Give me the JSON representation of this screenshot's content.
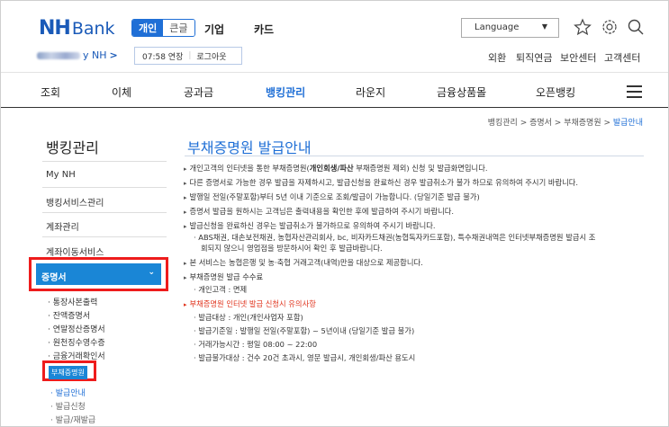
{
  "header": {
    "logo_nh": "NH",
    "logo_bank": "Bank",
    "seg_personal": "개인",
    "seg_corporate": "큰글",
    "nav_business": "기업",
    "nav_card": "카드",
    "language": "Language",
    "user_suffix": "y NH",
    "timer": "07:58 연장",
    "logout": "로그아웃",
    "util_links": [
      "외환",
      "퇴직연금",
      "보안센터",
      "고객센터"
    ]
  },
  "gnb": [
    "조회",
    "이체",
    "공과금",
    "뱅킹관리",
    "라운지",
    "금융상품몰",
    "오픈뱅킹"
  ],
  "breadcrumb": {
    "path": "뱅킹관리 > 증명서 > 부채증명원 > ",
    "current": "발급안내"
  },
  "sidebar": {
    "title": "뱅킹관리",
    "items": [
      "My NH",
      "뱅킹서비스관리",
      "계좌관리",
      "계좌이동서비스"
    ],
    "active": "증명서",
    "subs": [
      "· 통장사본출력",
      "· 잔액증명서",
      "· 연말정산증명서",
      "· 원천징수영수증",
      "· 금융거래확인서"
    ],
    "sub_active": "부채증명원",
    "subsubs": [
      "· 발급안내",
      "· 발급신청",
      "· 발급/재발급"
    ]
  },
  "main": {
    "title": "부채증명원 발급안내",
    "p1_a": "개인고객의 인터넷을 통한 부채증명원(",
    "p1_b": "개인회생/파산",
    "p1_c": " 부채증명원 제외) 신청 및 발급화면입니다.",
    "p2": "다른 증명서로 가능한 경우 발급을 자제하시고, 발급신청을 완료하신 경우 발급취소가 불가 하므로 유의하여 주시기 바랍니다.",
    "p3": "발행일 전일(주말포함)부터 5년 이내 기준으로 조회/발급이 가능합니다. (당일기준 발급 불가)",
    "p4": "증명서 발급을 원하시는 고객님은 출력내용을 확인한 후에 발급하여 주시기 바랍니다.",
    "p5": "발급신청을 완료하신 경우는 발급취소가 불가하므로 유의하여 주시기 바랍니다.",
    "p5_sub1": "· ABS채권, 대손보전채권, 농협자산관리회사, bc, 비자카드채권(농협독자카드포함), 특수채권내역은 인터넷부채증명원 발급시 조",
    "p5_sub2": "회되지 않으니 영업점을 방문하시어 확인 후 발급바랍니다.",
    "p6": "본 서비스는 농협은행 및 농·축협 거래고객(내역)만을 대상으로 제공합니다.",
    "p7": "부채증명원 발급 수수료",
    "p7_sub": "· 개인고객 : 면제",
    "p8": "부채증명원 인터넷 발급 신청시 유의사항",
    "p8_subs": [
      "· 발급대상 : 개인(개인사업자 포함)",
      "· 발급기준일 : 발행일 전일(주말포함) ~ 5년이내 (당일기준 발급 불가)",
      "· 거래가능시간 : 평일 08:00 ~ 22:00",
      "· 발급불가대상 : 건수 20건 초과시, 영문 발급시, 개인회생/파산 용도시"
    ]
  }
}
